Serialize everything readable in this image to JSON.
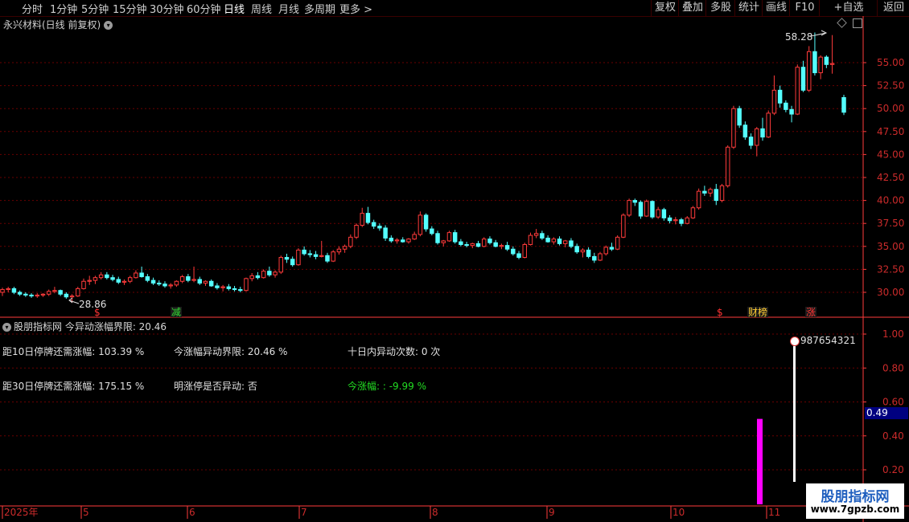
{
  "toolbar": {
    "periods": [
      "分时",
      "1分钟",
      "5分钟",
      "15分钟",
      "30分钟",
      "60分钟",
      "日线",
      "周线",
      "月线",
      "多周期",
      "更多 >"
    ],
    "active_period": "日线",
    "right_buttons": [
      "复权",
      "叠加",
      "多股",
      "统计",
      "画线",
      "F10",
      "+自选",
      "返回"
    ]
  },
  "chart": {
    "title": "永兴材料(日线 前复权)",
    "high_label": "58.28",
    "low_label": "28.86",
    "y_ticks": [
      "55.00",
      "52.50",
      "50.00",
      "47.50",
      "45.00",
      "42.50",
      "40.00",
      "37.50",
      "35.00",
      "32.50",
      "30.00"
    ],
    "markers": [
      "$",
      "减",
      "$",
      "财榜",
      "涨"
    ]
  },
  "indicator": {
    "header": "股朋指标网 今异动涨幅界限: 20.46",
    "row1": [
      "距10日停牌还需涨幅: 103.39 %",
      "今涨幅异动界限: 20.46 %",
      "十日内异动次数: 0 次"
    ],
    "row2": [
      "距30日停牌还需涨幅: 175.15 %",
      "明涨停是否异动: 否",
      "今涨幅: : -9.99 %"
    ],
    "y_ticks": [
      "1.00",
      "0.80",
      "0.60",
      "0.40",
      "0.20"
    ],
    "current_value": "0.49",
    "top_label": "987654321",
    "bar_values": [
      0.5,
      0.93
    ]
  },
  "xaxis": {
    "labels": [
      "2025年",
      "5",
      "6",
      "7",
      "8",
      "9",
      "10",
      "11"
    ]
  },
  "watermark": {
    "title": "股朋指标网",
    "url": "www.7gpzb.com"
  },
  "colors": {
    "up": "#ff3b3b",
    "down": "#54ffff",
    "grid": "#6a0000",
    "magenta": "#ff00ff"
  },
  "chart_data": {
    "type": "candlestick",
    "y_range": [
      28,
      59
    ],
    "ohlc": [
      [
        30.0,
        30.5,
        29.6,
        30.3
      ],
      [
        30.3,
        30.6,
        30.0,
        30.4
      ],
      [
        30.4,
        30.6,
        29.8,
        30.0
      ],
      [
        30.0,
        30.2,
        29.6,
        29.8
      ],
      [
        29.8,
        30.0,
        29.5,
        29.7
      ],
      [
        29.7,
        29.9,
        29.4,
        29.6
      ],
      [
        29.6,
        29.9,
        29.4,
        29.7
      ],
      [
        29.7,
        29.9,
        29.5,
        29.8
      ],
      [
        29.8,
        30.3,
        29.6,
        30.1
      ],
      [
        30.1,
        30.6,
        29.9,
        30.2
      ],
      [
        30.2,
        30.3,
        29.6,
        29.8
      ],
      [
        29.8,
        30.0,
        29.3,
        29.5
      ],
      [
        29.5,
        29.8,
        28.86,
        29.6
      ],
      [
        29.6,
        30.6,
        29.5,
        30.4
      ],
      [
        30.4,
        31.5,
        30.3,
        31.2
      ],
      [
        31.2,
        31.8,
        30.8,
        31.3
      ],
      [
        31.3,
        31.8,
        30.9,
        31.6
      ],
      [
        31.6,
        32.2,
        31.4,
        31.9
      ],
      [
        31.9,
        32.2,
        31.4,
        31.6
      ],
      [
        31.6,
        31.9,
        31.2,
        31.4
      ],
      [
        31.4,
        31.7,
        30.9,
        31.1
      ],
      [
        31.1,
        31.4,
        30.8,
        31.2
      ],
      [
        31.2,
        31.8,
        31.0,
        31.6
      ],
      [
        31.6,
        32.4,
        31.5,
        32.1
      ],
      [
        32.1,
        32.8,
        31.6,
        31.7
      ],
      [
        31.7,
        32.0,
        31.1,
        31.3
      ],
      [
        31.3,
        31.6,
        30.8,
        31.0
      ],
      [
        31.0,
        31.3,
        30.7,
        30.9
      ],
      [
        30.9,
        31.2,
        30.5,
        30.7
      ],
      [
        30.7,
        31.0,
        30.4,
        30.8
      ],
      [
        30.8,
        31.3,
        30.6,
        31.2
      ],
      [
        31.2,
        31.9,
        31.0,
        31.7
      ],
      [
        31.7,
        32.0,
        31.1,
        31.3
      ],
      [
        31.3,
        32.8,
        31.1,
        31.4
      ],
      [
        31.4,
        31.7,
        30.8,
        31.0
      ],
      [
        31.0,
        31.3,
        30.7,
        31.2
      ],
      [
        31.2,
        31.4,
        30.6,
        30.7
      ],
      [
        30.7,
        31.0,
        30.3,
        30.5
      ],
      [
        30.5,
        30.8,
        30.1,
        30.6
      ],
      [
        30.6,
        30.9,
        30.2,
        30.4
      ],
      [
        30.4,
        30.7,
        30.1,
        30.3
      ],
      [
        30.3,
        30.6,
        30.0,
        30.2
      ],
      [
        30.2,
        31.6,
        30.1,
        31.5
      ],
      [
        31.5,
        32.1,
        31.2,
        31.8
      ],
      [
        31.8,
        32.2,
        31.4,
        31.6
      ],
      [
        31.6,
        32.5,
        31.5,
        32.3
      ],
      [
        32.3,
        32.8,
        31.7,
        31.9
      ],
      [
        31.9,
        32.4,
        31.6,
        32.2
      ],
      [
        32.2,
        34.0,
        32.0,
        33.8
      ],
      [
        33.8,
        34.2,
        33.2,
        33.6
      ],
      [
        33.6,
        33.9,
        32.8,
        33.0
      ],
      [
        33.0,
        34.8,
        32.9,
        34.6
      ],
      [
        34.6,
        35.0,
        34.0,
        34.2
      ],
      [
        34.2,
        34.6,
        33.8,
        34.1
      ],
      [
        34.1,
        34.5,
        33.6,
        33.9
      ],
      [
        33.9,
        35.6,
        33.8,
        34.0
      ],
      [
        34.0,
        34.3,
        33.2,
        33.4
      ],
      [
        33.4,
        34.6,
        33.3,
        34.4
      ],
      [
        34.4,
        35.0,
        34.1,
        34.7
      ],
      [
        34.7,
        35.2,
        34.3,
        35.0
      ],
      [
        35.0,
        36.3,
        34.8,
        36.0
      ],
      [
        36.0,
        37.5,
        35.8,
        37.3
      ],
      [
        37.3,
        39.2,
        37.1,
        38.6
      ],
      [
        38.6,
        39.3,
        37.4,
        37.6
      ],
      [
        37.6,
        37.9,
        36.9,
        37.2
      ],
      [
        37.2,
        37.5,
        36.7,
        37.0
      ],
      [
        37.0,
        37.3,
        35.6,
        35.9
      ],
      [
        35.9,
        36.2,
        35.4,
        35.6
      ],
      [
        35.6,
        35.9,
        35.3,
        35.7
      ],
      [
        35.7,
        36.0,
        35.4,
        35.5
      ],
      [
        35.5,
        35.9,
        35.3,
        35.8
      ],
      [
        35.8,
        36.6,
        35.7,
        36.3
      ],
      [
        36.3,
        38.8,
        36.1,
        38.4
      ],
      [
        38.4,
        38.6,
        36.6,
        36.9
      ],
      [
        36.9,
        37.2,
        36.2,
        36.4
      ],
      [
        36.4,
        36.7,
        35.2,
        35.4
      ],
      [
        35.4,
        35.7,
        35.0,
        35.6
      ],
      [
        35.6,
        36.7,
        35.5,
        36.5
      ],
      [
        36.5,
        36.8,
        35.3,
        35.5
      ],
      [
        35.5,
        35.8,
        35.0,
        35.2
      ],
      [
        35.2,
        35.5,
        34.9,
        35.1
      ],
      [
        35.1,
        35.4,
        34.8,
        35.3
      ],
      [
        35.3,
        35.6,
        34.9,
        35.0
      ],
      [
        35.0,
        36.0,
        34.9,
        35.8
      ],
      [
        35.8,
        36.1,
        35.2,
        35.4
      ],
      [
        35.4,
        35.7,
        34.9,
        35.0
      ],
      [
        35.0,
        35.3,
        34.7,
        35.1
      ],
      [
        35.1,
        35.5,
        34.5,
        34.7
      ],
      [
        34.7,
        35.0,
        34.0,
        34.2
      ],
      [
        34.2,
        34.5,
        33.6,
        33.8
      ],
      [
        33.8,
        35.4,
        33.7,
        35.2
      ],
      [
        35.2,
        36.5,
        35.1,
        36.2
      ],
      [
        36.2,
        36.9,
        35.9,
        36.4
      ],
      [
        36.4,
        36.7,
        35.7,
        35.9
      ],
      [
        35.9,
        36.2,
        35.4,
        35.5
      ],
      [
        35.5,
        36.0,
        35.2,
        35.8
      ],
      [
        35.8,
        36.1,
        35.1,
        35.3
      ],
      [
        35.3,
        35.7,
        34.9,
        35.6
      ],
      [
        35.6,
        35.9,
        34.8,
        35.0
      ],
      [
        35.0,
        35.3,
        34.2,
        34.4
      ],
      [
        34.4,
        34.8,
        33.8,
        34.6
      ],
      [
        34.6,
        34.9,
        33.7,
        33.9
      ],
      [
        33.9,
        34.3,
        33.2,
        33.5
      ],
      [
        33.5,
        34.4,
        33.4,
        34.2
      ],
      [
        34.2,
        35.1,
        34.0,
        34.9
      ],
      [
        34.9,
        35.4,
        34.5,
        34.7
      ],
      [
        34.7,
        36.2,
        34.6,
        36.0
      ],
      [
        36.0,
        38.6,
        35.9,
        38.4
      ],
      [
        38.4,
        40.2,
        38.2,
        40.0
      ],
      [
        40.0,
        40.2,
        39.4,
        39.8
      ],
      [
        39.8,
        40.0,
        38.0,
        38.3
      ],
      [
        38.3,
        40.1,
        38.2,
        39.9
      ],
      [
        39.9,
        40.0,
        38.0,
        38.2
      ],
      [
        38.2,
        39.3,
        38.0,
        39.0
      ],
      [
        39.0,
        39.2,
        37.8,
        38.1
      ],
      [
        38.1,
        38.4,
        37.5,
        37.8
      ],
      [
        37.8,
        38.2,
        37.4,
        37.9
      ],
      [
        37.9,
        38.1,
        37.2,
        37.5
      ],
      [
        37.5,
        38.3,
        37.4,
        38.1
      ],
      [
        38.1,
        39.4,
        38.0,
        39.2
      ],
      [
        39.2,
        41.3,
        39.0,
        41.0
      ],
      [
        41.0,
        41.6,
        40.5,
        40.8
      ],
      [
        40.8,
        41.4,
        40.4,
        41.2
      ],
      [
        41.2,
        41.8,
        39.5,
        40.0
      ],
      [
        40.0,
        41.8,
        39.8,
        41.6
      ],
      [
        41.6,
        46.0,
        41.4,
        45.8
      ],
      [
        45.8,
        50.3,
        45.6,
        50.0
      ],
      [
        50.0,
        50.3,
        47.9,
        48.2
      ],
      [
        48.2,
        48.6,
        46.6,
        46.9
      ],
      [
        46.9,
        47.3,
        45.6,
        46.0
      ],
      [
        46.0,
        48.0,
        44.8,
        47.8
      ],
      [
        47.8,
        49.0,
        46.5,
        46.9
      ],
      [
        46.9,
        49.8,
        46.8,
        49.5
      ],
      [
        49.5,
        53.6,
        49.3,
        52.0
      ],
      [
        52.0,
        52.5,
        50.1,
        50.6
      ],
      [
        50.6,
        50.9,
        49.6,
        49.9
      ],
      [
        49.9,
        50.3,
        48.5,
        49.4
      ],
      [
        49.4,
        54.8,
        49.3,
        54.5
      ],
      [
        54.5,
        55.2,
        51.8,
        52.0
      ],
      [
        52.0,
        56.8,
        51.8,
        56.2
      ],
      [
        56.2,
        58.28,
        53.6,
        53.9
      ],
      [
        53.9,
        55.8,
        53.2,
        55.6
      ],
      [
        55.6,
        55.8,
        54.4,
        54.8
      ],
      [
        54.8,
        58.0,
        53.8,
        54.9
      ],
      [
        null,
        null,
        null,
        null
      ],
      [
        51.2,
        51.5,
        49.3,
        49.6
      ]
    ]
  }
}
